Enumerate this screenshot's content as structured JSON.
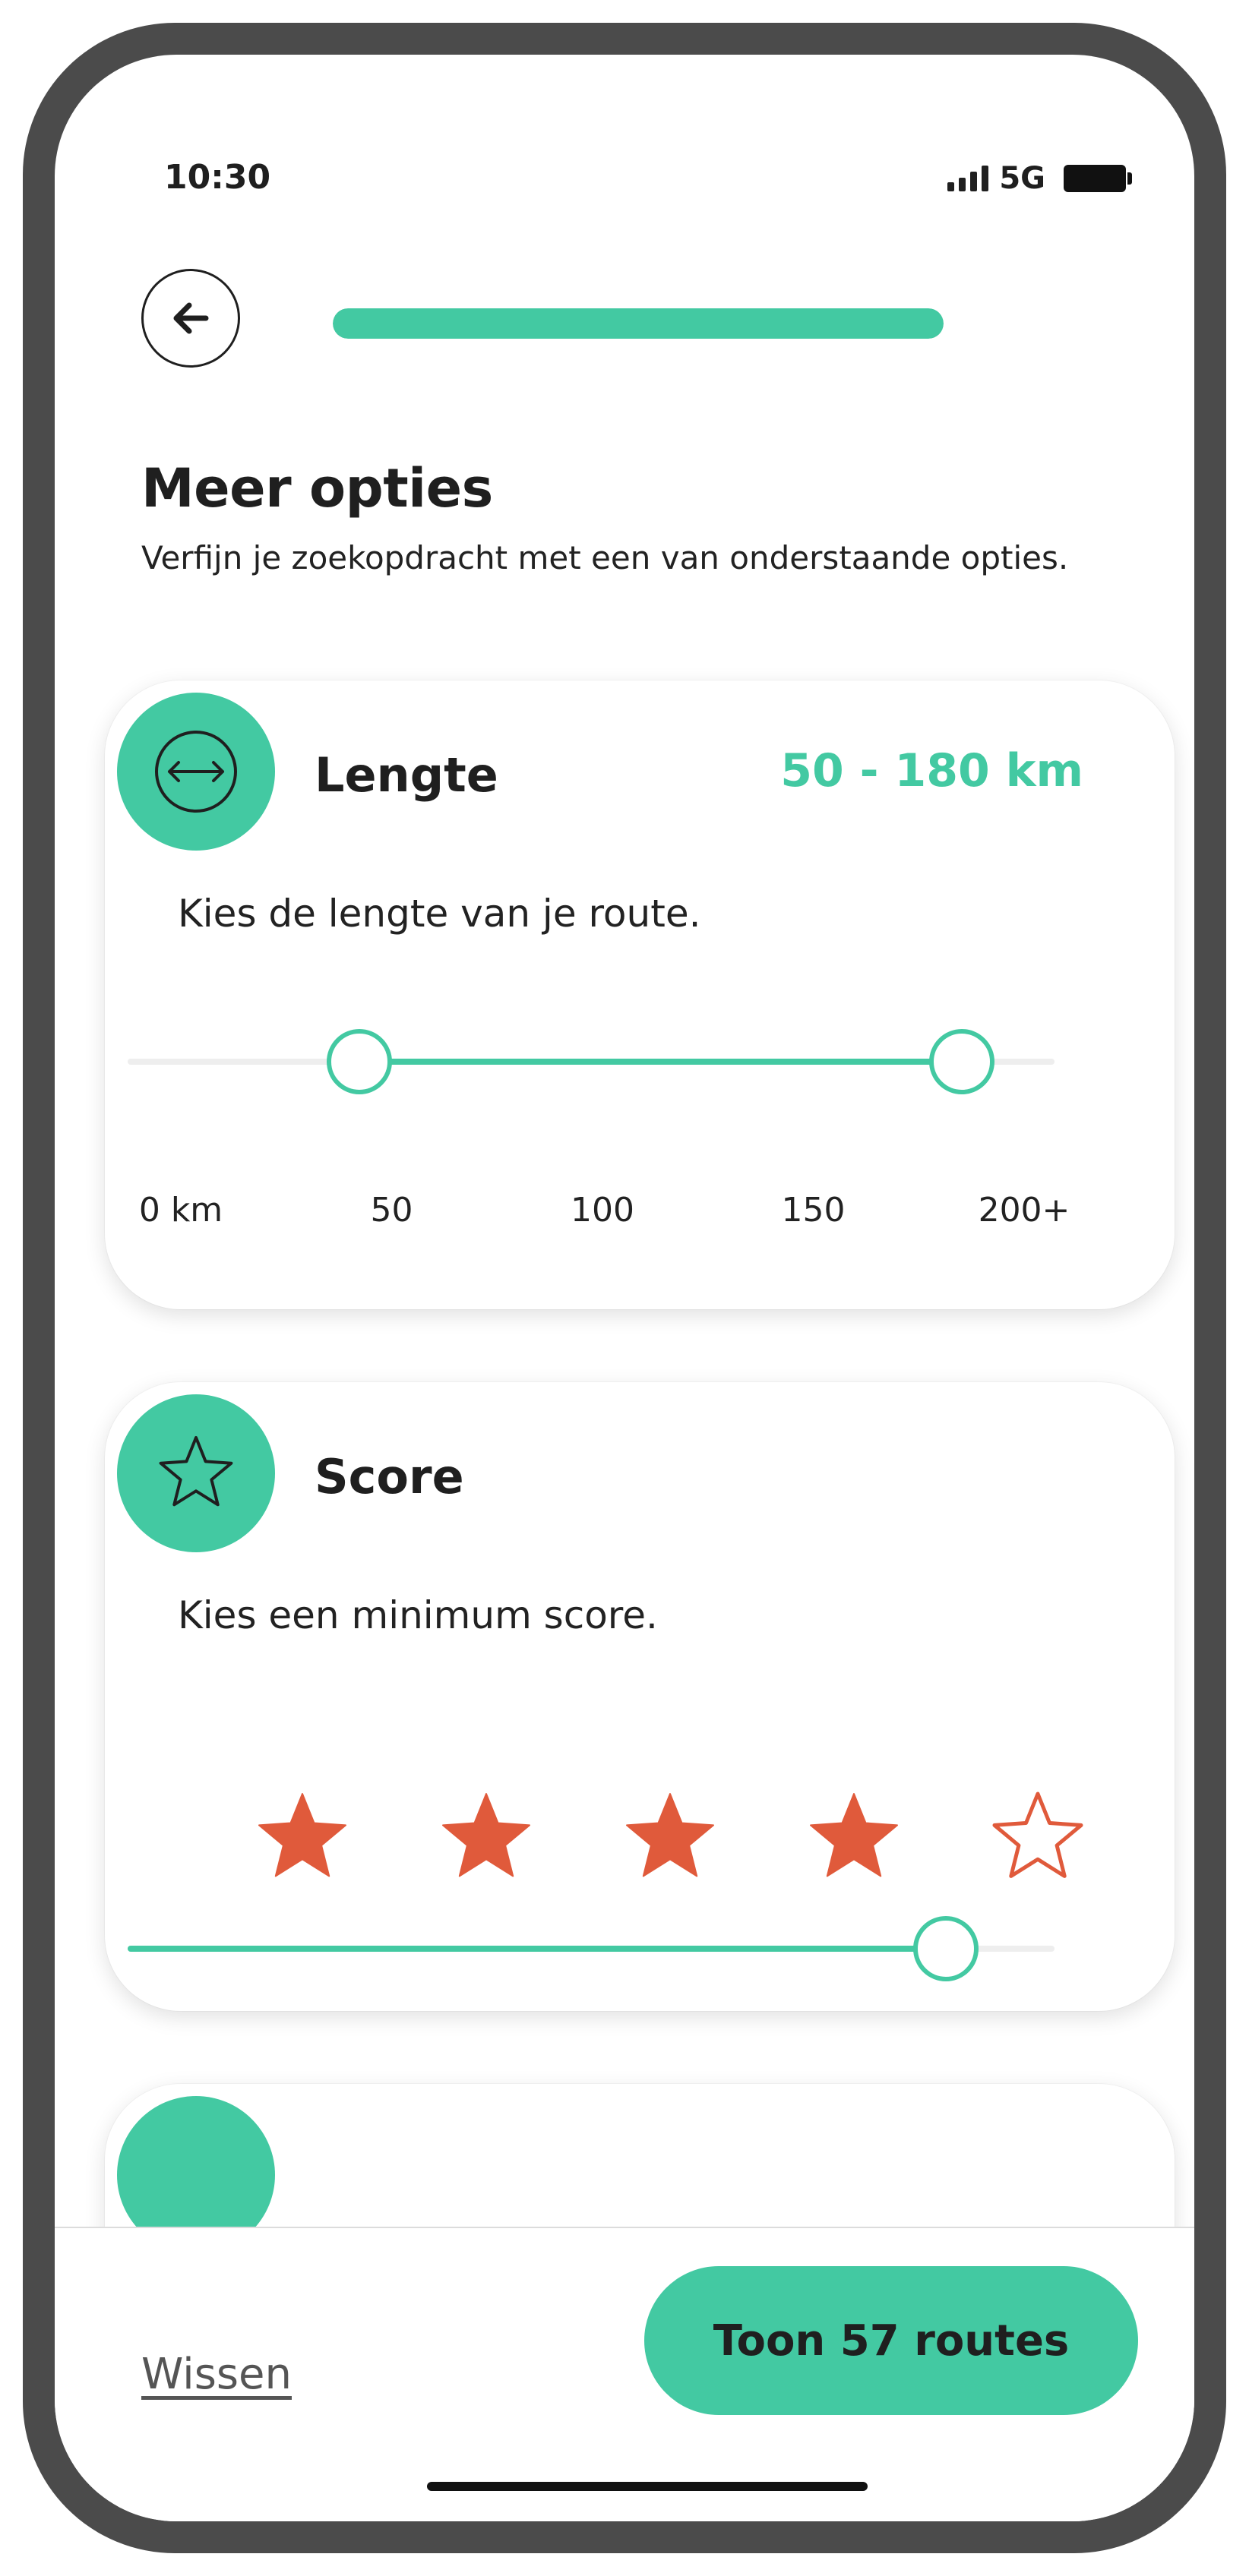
{
  "status_bar": {
    "time": "10:30",
    "network": "5G"
  },
  "header": {
    "progress_value": 1.0,
    "back_icon": "arrow-left-icon"
  },
  "page": {
    "title": "Meer opties",
    "subtitle": "Verfijn je zoekopdracht met een van onderstaande opties."
  },
  "length_card": {
    "icon": "horizontal-arrows-icon",
    "title": "Lengte",
    "value": "50 - 180 km",
    "description": "Kies de lengte van je route.",
    "range_min": 0,
    "range_max": 200,
    "selected_min": 50,
    "selected_max": 180,
    "ticks": [
      "0 km",
      "50",
      "100",
      "150",
      "200+"
    ]
  },
  "score_card": {
    "icon": "star-outline-icon",
    "title": "Score",
    "description": "Kies een minimum score.",
    "max_score": 5,
    "selected_score": 4
  },
  "bottom_bar": {
    "clear_label": "Wissen",
    "cta_label": "Toon 57 routes"
  },
  "colors": {
    "accent": "#43c9a2",
    "star": "#e05a3b",
    "text": "#1f1f1f"
  }
}
